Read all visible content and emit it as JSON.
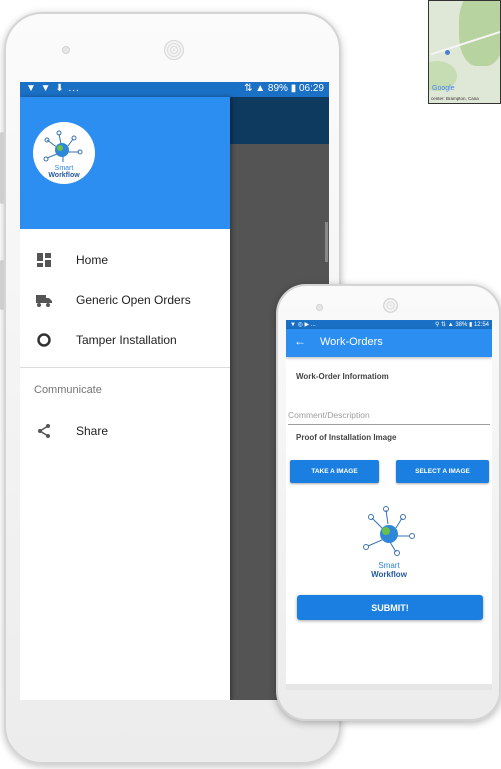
{
  "map": {
    "google_label": "Google",
    "center_label": "center: Brampton, Cana"
  },
  "drawer_phone": {
    "status_left": "▼ ▼ ⬇ ...",
    "status_right": "⇅ ▲ 89% ▮ 06:29",
    "logo": {
      "line1": "Smart",
      "line2": "Workflow"
    },
    "menu": [
      {
        "label": "Home",
        "icon": "dashboard-icon"
      },
      {
        "label": "Generic Open Orders",
        "icon": "truck-icon"
      },
      {
        "label": "Tamper Installation",
        "icon": "circle-icon"
      }
    ],
    "section_title": "Communicate",
    "share_label": "Share"
  },
  "form_phone": {
    "status_left": "▼ ◎ ▶ ...",
    "status_right": "⚲ ⇅ ▲ 38% ▮ 12:54",
    "title": "Work-Orders",
    "info_label": "Work-Order Informatiom",
    "comment_placeholder": "Comment/Description",
    "proof_label": "Proof of Installation Image",
    "take_image": "TAKE A IMAGE",
    "select_image": "SELECT A IMAGE",
    "logo": {
      "line1": "Smart",
      "line2": "Workflow"
    },
    "submit": "SUBMIT!"
  },
  "colors": {
    "primary": "#2b8ef0",
    "status_bar": "#1a70c4",
    "dark_toolbar": "#0d3a5e",
    "scrim": "#545454",
    "button": "#1a7fe0"
  }
}
